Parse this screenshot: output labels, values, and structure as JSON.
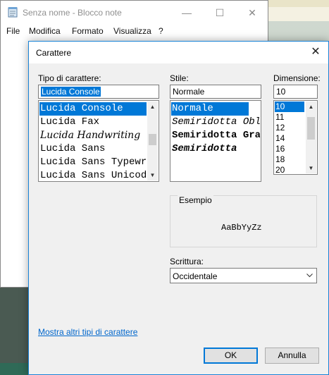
{
  "notepad": {
    "title": "Senza nome - Blocco note",
    "window_controls": {
      "minimize": "—",
      "maximize": "☐",
      "close": "✕"
    },
    "menu": [
      "File",
      "Modifica",
      "Formato",
      "Visualizza",
      "?"
    ]
  },
  "dialog": {
    "title": "Carattere",
    "close": "✕",
    "font": {
      "label": "Tipo di carattere:",
      "value": "Lucida Console",
      "items": [
        "Lucida Console",
        "Lucida Fax",
        "Lucida Handwriting",
        "Lucida Sans",
        "Lucida Sans Typewriter",
        "Lucida Sans Unicode"
      ]
    },
    "style": {
      "label": "Stile:",
      "value": "Normale",
      "items": [
        "Normale",
        "Semiridotta Obliquo",
        "Semiridotta Grassetto",
        "Semiridotta"
      ]
    },
    "size": {
      "label": "Dimensione:",
      "value": "10",
      "items": [
        "10",
        "11",
        "12",
        "14",
        "16",
        "18",
        "20"
      ]
    },
    "sample": {
      "label": "Esempio",
      "text": "AaBbYyZz"
    },
    "script": {
      "label": "Scrittura:",
      "value": "Occidentale"
    },
    "more_fonts_link": "Mostra altri tipi di carattere",
    "ok": "OK",
    "cancel": "Annulla"
  }
}
